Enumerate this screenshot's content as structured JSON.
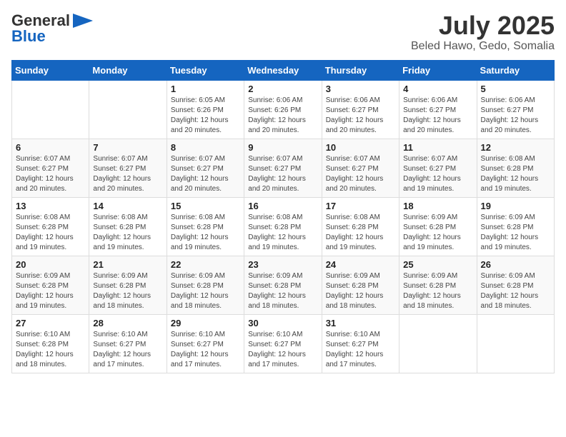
{
  "header": {
    "logo_general": "General",
    "logo_blue": "Blue",
    "title": "July 2025",
    "subtitle": "Beled Hawo, Gedo, Somalia"
  },
  "days_of_week": [
    "Sunday",
    "Monday",
    "Tuesday",
    "Wednesday",
    "Thursday",
    "Friday",
    "Saturday"
  ],
  "weeks": [
    [
      {
        "num": "",
        "sunrise": "",
        "sunset": "",
        "daylight": ""
      },
      {
        "num": "",
        "sunrise": "",
        "sunset": "",
        "daylight": ""
      },
      {
        "num": "1",
        "sunrise": "Sunrise: 6:05 AM",
        "sunset": "Sunset: 6:26 PM",
        "daylight": "Daylight: 12 hours and 20 minutes."
      },
      {
        "num": "2",
        "sunrise": "Sunrise: 6:06 AM",
        "sunset": "Sunset: 6:26 PM",
        "daylight": "Daylight: 12 hours and 20 minutes."
      },
      {
        "num": "3",
        "sunrise": "Sunrise: 6:06 AM",
        "sunset": "Sunset: 6:27 PM",
        "daylight": "Daylight: 12 hours and 20 minutes."
      },
      {
        "num": "4",
        "sunrise": "Sunrise: 6:06 AM",
        "sunset": "Sunset: 6:27 PM",
        "daylight": "Daylight: 12 hours and 20 minutes."
      },
      {
        "num": "5",
        "sunrise": "Sunrise: 6:06 AM",
        "sunset": "Sunset: 6:27 PM",
        "daylight": "Daylight: 12 hours and 20 minutes."
      }
    ],
    [
      {
        "num": "6",
        "sunrise": "Sunrise: 6:07 AM",
        "sunset": "Sunset: 6:27 PM",
        "daylight": "Daylight: 12 hours and 20 minutes."
      },
      {
        "num": "7",
        "sunrise": "Sunrise: 6:07 AM",
        "sunset": "Sunset: 6:27 PM",
        "daylight": "Daylight: 12 hours and 20 minutes."
      },
      {
        "num": "8",
        "sunrise": "Sunrise: 6:07 AM",
        "sunset": "Sunset: 6:27 PM",
        "daylight": "Daylight: 12 hours and 20 minutes."
      },
      {
        "num": "9",
        "sunrise": "Sunrise: 6:07 AM",
        "sunset": "Sunset: 6:27 PM",
        "daylight": "Daylight: 12 hours and 20 minutes."
      },
      {
        "num": "10",
        "sunrise": "Sunrise: 6:07 AM",
        "sunset": "Sunset: 6:27 PM",
        "daylight": "Daylight: 12 hours and 20 minutes."
      },
      {
        "num": "11",
        "sunrise": "Sunrise: 6:07 AM",
        "sunset": "Sunset: 6:27 PM",
        "daylight": "Daylight: 12 hours and 19 minutes."
      },
      {
        "num": "12",
        "sunrise": "Sunrise: 6:08 AM",
        "sunset": "Sunset: 6:28 PM",
        "daylight": "Daylight: 12 hours and 19 minutes."
      }
    ],
    [
      {
        "num": "13",
        "sunrise": "Sunrise: 6:08 AM",
        "sunset": "Sunset: 6:28 PM",
        "daylight": "Daylight: 12 hours and 19 minutes."
      },
      {
        "num": "14",
        "sunrise": "Sunrise: 6:08 AM",
        "sunset": "Sunset: 6:28 PM",
        "daylight": "Daylight: 12 hours and 19 minutes."
      },
      {
        "num": "15",
        "sunrise": "Sunrise: 6:08 AM",
        "sunset": "Sunset: 6:28 PM",
        "daylight": "Daylight: 12 hours and 19 minutes."
      },
      {
        "num": "16",
        "sunrise": "Sunrise: 6:08 AM",
        "sunset": "Sunset: 6:28 PM",
        "daylight": "Daylight: 12 hours and 19 minutes."
      },
      {
        "num": "17",
        "sunrise": "Sunrise: 6:08 AM",
        "sunset": "Sunset: 6:28 PM",
        "daylight": "Daylight: 12 hours and 19 minutes."
      },
      {
        "num": "18",
        "sunrise": "Sunrise: 6:09 AM",
        "sunset": "Sunset: 6:28 PM",
        "daylight": "Daylight: 12 hours and 19 minutes."
      },
      {
        "num": "19",
        "sunrise": "Sunrise: 6:09 AM",
        "sunset": "Sunset: 6:28 PM",
        "daylight": "Daylight: 12 hours and 19 minutes."
      }
    ],
    [
      {
        "num": "20",
        "sunrise": "Sunrise: 6:09 AM",
        "sunset": "Sunset: 6:28 PM",
        "daylight": "Daylight: 12 hours and 19 minutes."
      },
      {
        "num": "21",
        "sunrise": "Sunrise: 6:09 AM",
        "sunset": "Sunset: 6:28 PM",
        "daylight": "Daylight: 12 hours and 18 minutes."
      },
      {
        "num": "22",
        "sunrise": "Sunrise: 6:09 AM",
        "sunset": "Sunset: 6:28 PM",
        "daylight": "Daylight: 12 hours and 18 minutes."
      },
      {
        "num": "23",
        "sunrise": "Sunrise: 6:09 AM",
        "sunset": "Sunset: 6:28 PM",
        "daylight": "Daylight: 12 hours and 18 minutes."
      },
      {
        "num": "24",
        "sunrise": "Sunrise: 6:09 AM",
        "sunset": "Sunset: 6:28 PM",
        "daylight": "Daylight: 12 hours and 18 minutes."
      },
      {
        "num": "25",
        "sunrise": "Sunrise: 6:09 AM",
        "sunset": "Sunset: 6:28 PM",
        "daylight": "Daylight: 12 hours and 18 minutes."
      },
      {
        "num": "26",
        "sunrise": "Sunrise: 6:09 AM",
        "sunset": "Sunset: 6:28 PM",
        "daylight": "Daylight: 12 hours and 18 minutes."
      }
    ],
    [
      {
        "num": "27",
        "sunrise": "Sunrise: 6:10 AM",
        "sunset": "Sunset: 6:28 PM",
        "daylight": "Daylight: 12 hours and 18 minutes."
      },
      {
        "num": "28",
        "sunrise": "Sunrise: 6:10 AM",
        "sunset": "Sunset: 6:27 PM",
        "daylight": "Daylight: 12 hours and 17 minutes."
      },
      {
        "num": "29",
        "sunrise": "Sunrise: 6:10 AM",
        "sunset": "Sunset: 6:27 PM",
        "daylight": "Daylight: 12 hours and 17 minutes."
      },
      {
        "num": "30",
        "sunrise": "Sunrise: 6:10 AM",
        "sunset": "Sunset: 6:27 PM",
        "daylight": "Daylight: 12 hours and 17 minutes."
      },
      {
        "num": "31",
        "sunrise": "Sunrise: 6:10 AM",
        "sunset": "Sunset: 6:27 PM",
        "daylight": "Daylight: 12 hours and 17 minutes."
      },
      {
        "num": "",
        "sunrise": "",
        "sunset": "",
        "daylight": ""
      },
      {
        "num": "",
        "sunrise": "",
        "sunset": "",
        "daylight": ""
      }
    ]
  ]
}
